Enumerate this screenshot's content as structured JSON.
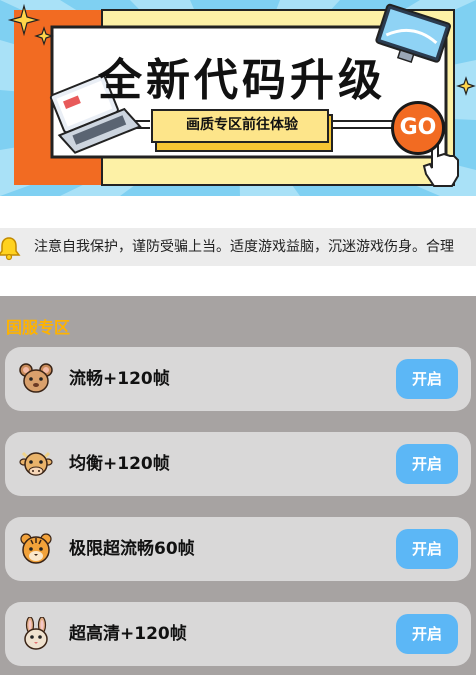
{
  "banner": {
    "title": "全新代码升级",
    "subtitle": "画质专区前往体验",
    "go_label": "GO"
  },
  "notice": {
    "icon": "bell-icon",
    "text": "注意自我保护，谨防受骗上当。适度游戏益脑，沉迷游戏伤身。合理"
  },
  "section": {
    "title": "国服专区",
    "items": [
      {
        "label": "流畅+120帧",
        "icon": "mouse-avatar-icon",
        "button": "开启"
      },
      {
        "label": "均衡+120帧",
        "icon": "ox-avatar-icon",
        "button": "开启"
      },
      {
        "label": "极限超流畅60帧",
        "icon": "tiger-avatar-icon",
        "button": "开启"
      },
      {
        "label": "超高清+120帧",
        "icon": "rabbit-avatar-icon",
        "button": "开启"
      }
    ]
  },
  "colors": {
    "accent_blue": "#5cb7f6",
    "section_title": "#ffb300",
    "banner_orange": "#f26b22",
    "banner_yellow": "#fdf1a6"
  }
}
